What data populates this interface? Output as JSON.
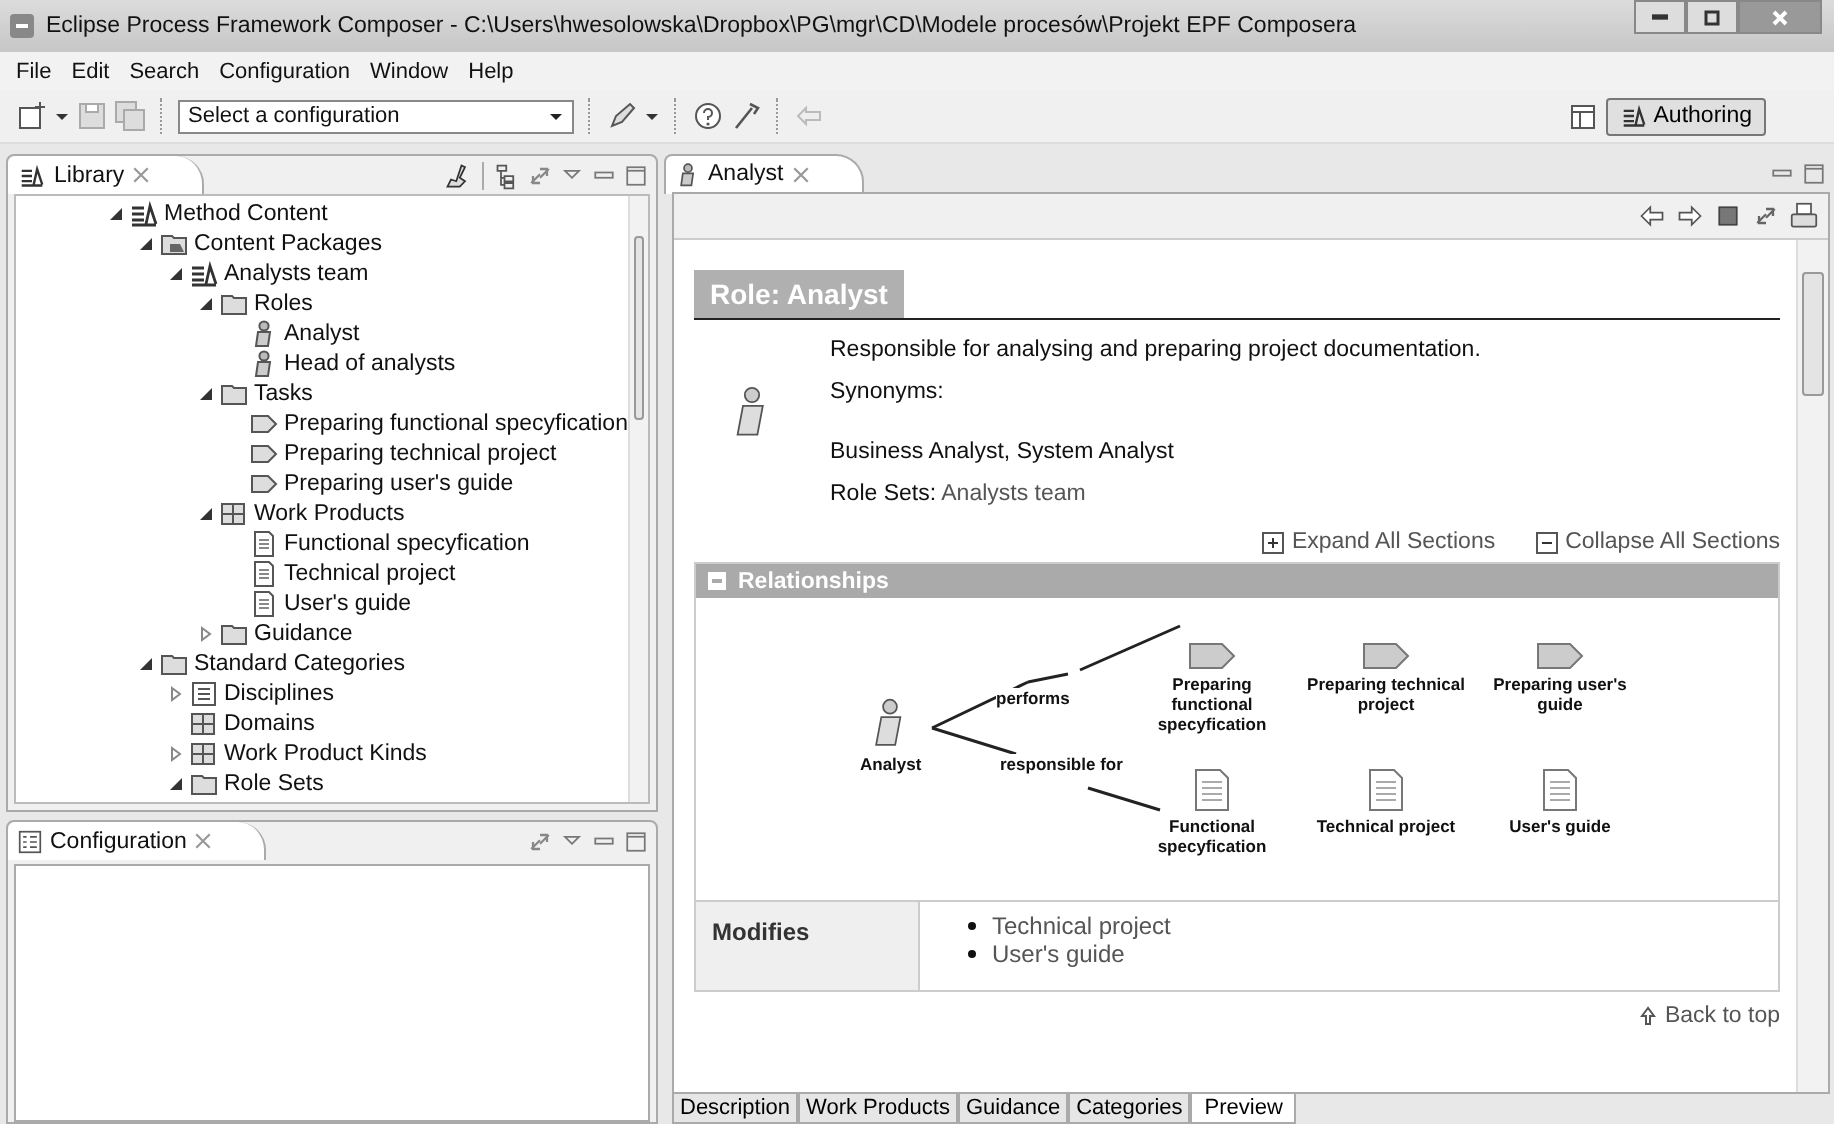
{
  "window": {
    "title": "Eclipse Process Framework Composer - C:\\Users\\hwesolowska\\Dropbox\\PG\\mgr\\CD\\Modele procesów\\Projekt EPF Composera"
  },
  "menu": [
    "File",
    "Edit",
    "Search",
    "Configuration",
    "Window",
    "Help"
  ],
  "toolbar": {
    "configuration_select": "Select a configuration",
    "perspective": {
      "label": "Authoring",
      "selected": true
    }
  },
  "library": {
    "title": "Library",
    "tree": [
      {
        "label": "Method Content",
        "kind": "library",
        "expanded": true,
        "children": [
          {
            "label": "Content Packages",
            "kind": "packages",
            "expanded": true,
            "children": [
              {
                "label": "Analysts team",
                "kind": "library",
                "expanded": true,
                "children": [
                  {
                    "label": "Roles",
                    "kind": "folder",
                    "expanded": true,
                    "children": [
                      {
                        "label": "Analyst",
                        "kind": "role"
                      },
                      {
                        "label": "Head of analysts",
                        "kind": "role"
                      }
                    ]
                  },
                  {
                    "label": "Tasks",
                    "kind": "folder",
                    "expanded": true,
                    "children": [
                      {
                        "label": "Preparing functional specyfication",
                        "kind": "task"
                      },
                      {
                        "label": "Preparing technical project",
                        "kind": "task"
                      },
                      {
                        "label": "Preparing user's guide",
                        "kind": "task"
                      }
                    ]
                  },
                  {
                    "label": "Work Products",
                    "kind": "grid",
                    "expanded": true,
                    "children": [
                      {
                        "label": "Functional specyfication",
                        "kind": "document"
                      },
                      {
                        "label": "Technical project",
                        "kind": "document"
                      },
                      {
                        "label": "User's guide",
                        "kind": "document"
                      }
                    ]
                  },
                  {
                    "label": "Guidance",
                    "kind": "folder",
                    "expanded": false
                  }
                ]
              }
            ]
          },
          {
            "label": "Standard Categories",
            "kind": "folder",
            "expanded": true,
            "children": [
              {
                "label": "Disciplines",
                "kind": "list",
                "expanded": false
              },
              {
                "label": "Domains",
                "kind": "grid"
              },
              {
                "label": "Work Product Kinds",
                "kind": "grid",
                "expanded": false
              },
              {
                "label": "Role Sets",
                "kind": "folder",
                "expanded": true
              }
            ]
          }
        ]
      }
    ]
  },
  "configuration_view": {
    "title": "Configuration"
  },
  "editor": {
    "tab": {
      "label": "Analyst",
      "selected": true
    },
    "heading": "Role: Analyst",
    "description": "Responsible for analysing and preparing project documentation.",
    "synonyms_label": "Synonyms:",
    "synonyms": "Business Analyst, System Analyst",
    "role_sets_label": "Role Sets:",
    "role_sets": "Analysts team",
    "expand_all": "Expand All Sections",
    "collapse_all": "Collapse All Sections",
    "relationships": {
      "title": "Relationships",
      "role": "Analyst",
      "performs_label": "performs",
      "responsible_label": "responsible for",
      "tasks": [
        "Preparing functional specyfication",
        "Preparing technical project",
        "Preparing user's guide"
      ],
      "work_products": [
        "Functional specyfication",
        "Technical project",
        "User's guide"
      ]
    },
    "modifies": {
      "label": "Modifies",
      "items": [
        "Technical project",
        "User's guide"
      ]
    },
    "back_to_top": "Back to top",
    "bottom_tabs": [
      {
        "label": "Description",
        "selected": false
      },
      {
        "label": "Work Products",
        "selected": false
      },
      {
        "label": "Guidance",
        "selected": false
      },
      {
        "label": "Categories",
        "selected": false
      },
      {
        "label": "Preview",
        "selected": true
      }
    ]
  }
}
